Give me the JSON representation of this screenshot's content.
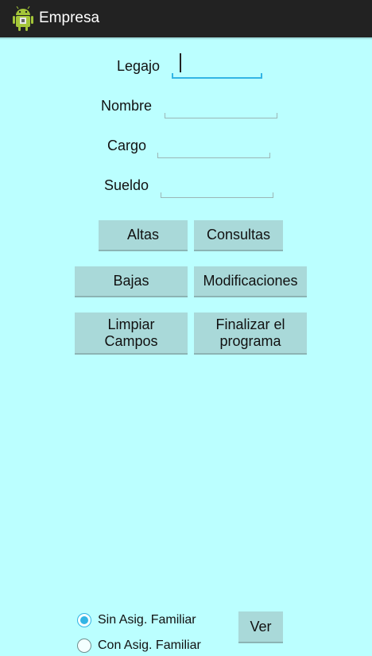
{
  "app": {
    "title": "Empresa",
    "icon": "android-icon"
  },
  "form": {
    "legajo_label": "Legajo",
    "nombre_label": "Nombre",
    "cargo_label": "Cargo",
    "sueldo_label": "Sueldo",
    "legajo_value": "",
    "nombre_value": "",
    "cargo_value": "",
    "sueldo_value": ""
  },
  "buttons": {
    "altas": "Altas",
    "consultas": "Consultas",
    "bajas": "Bajas",
    "modificaciones": "Modificaciones",
    "limpiar": "Limpiar\nCampos",
    "finalizar": "Finalizar el\nprograma",
    "ver": "Ver"
  },
  "radios": {
    "sin_asig": "Sin Asig. Familiar",
    "con_asig": "Con Asig. Familiar",
    "selected": "sin_asig"
  },
  "colors": {
    "background": "#bbffff",
    "actionbar": "#222222",
    "button": "#a9d9d9",
    "accent": "#33b5e5"
  }
}
